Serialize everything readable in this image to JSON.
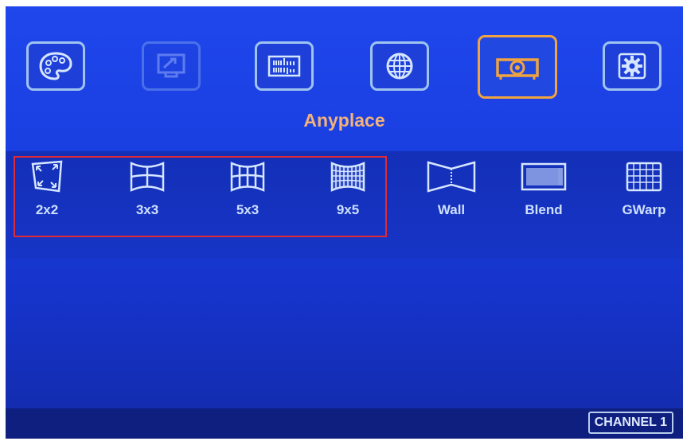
{
  "top_menu": {
    "items": [
      {
        "icon": "palette-icon",
        "state": "normal"
      },
      {
        "icon": "display-settings-icon",
        "state": "disabled"
      },
      {
        "icon": "audio-mixer-icon",
        "state": "normal"
      },
      {
        "icon": "globe-icon",
        "state": "normal"
      },
      {
        "icon": "projector-icon",
        "state": "selected"
      },
      {
        "icon": "gear-icon",
        "state": "normal"
      }
    ],
    "selected_title": "Anyplace"
  },
  "anyplace_options": [
    {
      "label": "2x2",
      "icon": "warp-2x2-icon"
    },
    {
      "label": "3x3",
      "icon": "warp-3x3-icon"
    },
    {
      "label": "5x3",
      "icon": "warp-5x3-icon"
    },
    {
      "label": "9x5",
      "icon": "warp-9x5-icon"
    },
    {
      "label": "Wall",
      "icon": "wall-icon"
    },
    {
      "label": "Blend",
      "icon": "blend-icon"
    },
    {
      "label": "GWarp",
      "icon": "gwarp-icon"
    }
  ],
  "status": {
    "channel": "CHANNEL 1"
  },
  "colors": {
    "background": "#1b3fe0",
    "selected_border": "#f0a340",
    "highlight_box": "#e02a35",
    "title_text": "#f3b279"
  }
}
